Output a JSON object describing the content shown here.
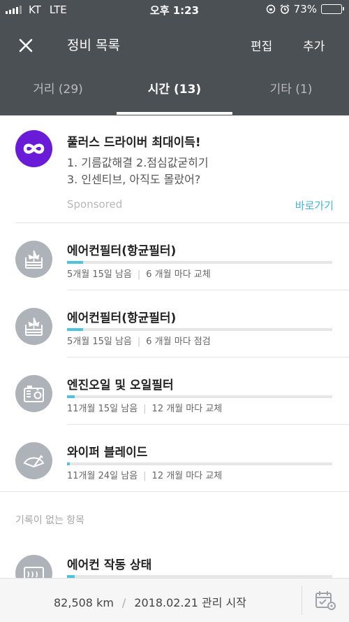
{
  "status_bar": {
    "carrier": "KT",
    "network": "LTE",
    "time": "오후 1:23",
    "battery_percent": "73%",
    "battery_level": 0.73
  },
  "header": {
    "title": "정비 목록",
    "edit_label": "편집",
    "add_label": "추가"
  },
  "tabs": [
    {
      "label": "거리 (29)",
      "active": false
    },
    {
      "label": "시간 (13)",
      "active": true
    },
    {
      "label": "기타 (1)",
      "active": false
    }
  ],
  "ad": {
    "title": "풀러스 드라이버 최대이득!",
    "line1": "1. 기름값해결 2.점심값굳히기",
    "line2": "3. 인센티브, 아직도 몰랐어?",
    "sponsored": "Sponsored",
    "cta": "바로가기",
    "brand_color": "#6a1bd8"
  },
  "items": [
    {
      "name": "에어컨필터(항균필터)",
      "remaining": "5개월 15일 남음",
      "interval": "6 개월 마다 교체",
      "icon": "aircon-filter-icon",
      "progress": 0.06
    },
    {
      "name": "에어컨필터(항균필터)",
      "remaining": "5개월 15일 남음",
      "interval": "6 개월 마다 점검",
      "icon": "aircon-filter-icon",
      "progress": 0.06
    },
    {
      "name": "엔진오일 및 오일필터",
      "remaining": "11개월 15일 남음",
      "interval": "12 개월 마다 교체",
      "icon": "engine-oil-icon",
      "progress": 0.03
    },
    {
      "name": "와이퍼 블레이드",
      "remaining": "11개월 24일 남음",
      "interval": "12 개월 마다 교체",
      "icon": "wiper-icon",
      "progress": 0.01
    }
  ],
  "section_no_record": "기록이 없는 항목",
  "no_record_items": [
    {
      "name": "에어컨 작동 상태",
      "icon": "aircon-status-icon",
      "progress": 0.03
    }
  ],
  "footer": {
    "mileage": "82,508 km",
    "start": "2018.02.21 관리 시작"
  },
  "colors": {
    "header_bg": "#4b5055",
    "accent": "#4ec3dd",
    "icon_bg": "#adb3b8"
  }
}
